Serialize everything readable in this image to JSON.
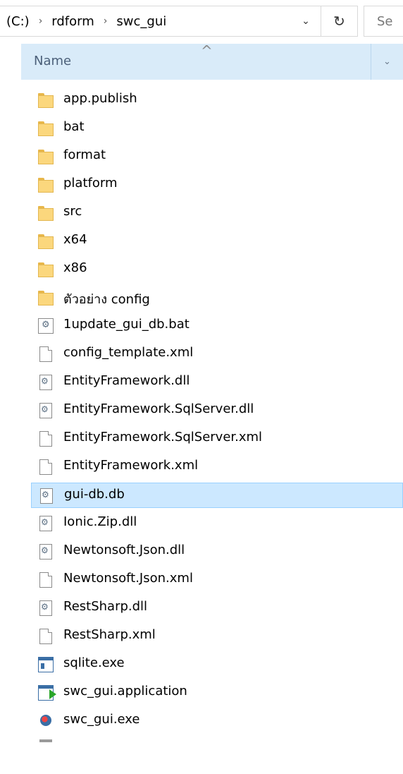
{
  "address_bar": {
    "crumbs": [
      "(C:)",
      "rdform",
      "swc_gui"
    ],
    "search_placeholder": "Se"
  },
  "column_header": {
    "name_label": "Name"
  },
  "files": [
    {
      "name": "app.publish",
      "icon": "folder-icon"
    },
    {
      "name": "bat",
      "icon": "folder-icon"
    },
    {
      "name": "format",
      "icon": "folder-icon"
    },
    {
      "name": "platform",
      "icon": "folder-icon"
    },
    {
      "name": "src",
      "icon": "folder-icon"
    },
    {
      "name": "x64",
      "icon": "folder-icon"
    },
    {
      "name": "x86",
      "icon": "folder-icon"
    },
    {
      "name": "ตัวอย่าง config",
      "icon": "folder-icon"
    },
    {
      "name": "1update_gui_db.bat",
      "icon": "bat-file-icon"
    },
    {
      "name": "config_template.xml",
      "icon": "document-icon"
    },
    {
      "name": "EntityFramework.dll",
      "icon": "dll-file-icon"
    },
    {
      "name": "EntityFramework.SqlServer.dll",
      "icon": "dll-file-icon"
    },
    {
      "name": "EntityFramework.SqlServer.xml",
      "icon": "document-icon"
    },
    {
      "name": "EntityFramework.xml",
      "icon": "document-icon"
    },
    {
      "name": "gui-db.db",
      "icon": "dll-file-icon",
      "selected": true
    },
    {
      "name": "Ionic.Zip.dll",
      "icon": "dll-file-icon"
    },
    {
      "name": "Newtonsoft.Json.dll",
      "icon": "dll-file-icon"
    },
    {
      "name": "Newtonsoft.Json.xml",
      "icon": "document-icon"
    },
    {
      "name": "RestSharp.dll",
      "icon": "dll-file-icon"
    },
    {
      "name": "RestSharp.xml",
      "icon": "document-icon"
    },
    {
      "name": "sqlite.exe",
      "icon": "window-exe-icon"
    },
    {
      "name": "swc_gui.application",
      "icon": "application-manifest-icon"
    },
    {
      "name": "swc_gui.exe",
      "icon": "custom-exe-icon"
    }
  ]
}
